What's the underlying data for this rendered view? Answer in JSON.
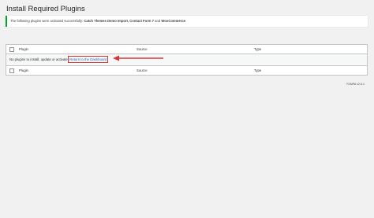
{
  "page": {
    "title": "Install Required Plugins"
  },
  "notice": {
    "prefix": "The following plugins were activated successfully:",
    "plugins": "Catch Themes Demo Import, Contact Form 7",
    "conjunction": "and",
    "last_plugin": "WooCommerce",
    "suffix": ".",
    "accent_color": "#00a32a"
  },
  "table": {
    "headers": {
      "plugin": "Plugin",
      "source": "Source",
      "type": "Type"
    },
    "empty_message": "No plugins to install, update or activate.",
    "dashboard_link": "Return to the Dashboard",
    "footers": {
      "plugin": "Plugin",
      "source": "Source",
      "type": "Type"
    }
  },
  "annotation": {
    "color": "#d63638",
    "arrow_icon": "left-arrow-icon"
  },
  "footer": {
    "version": "TGMPA v2.6.1"
  }
}
